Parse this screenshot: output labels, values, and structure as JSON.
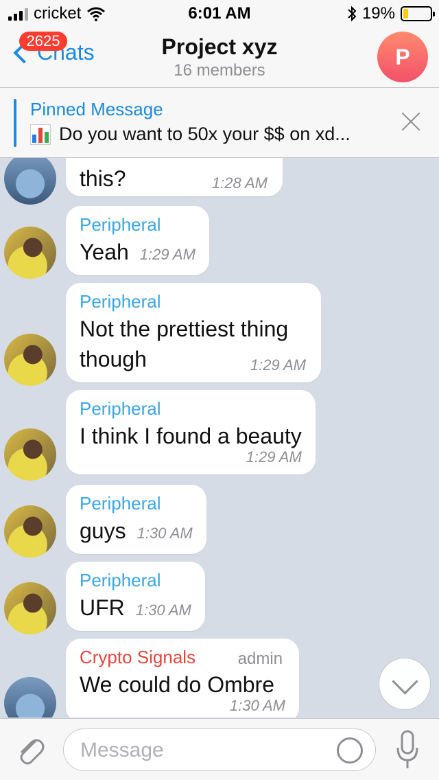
{
  "status_bar": {
    "carrier": "cricket",
    "time": "6:01 AM",
    "battery_percent": "19%",
    "battery_level": 0.19,
    "icons": [
      "signal-icon",
      "wifi-icon",
      "bluetooth-icon",
      "battery-icon"
    ]
  },
  "header": {
    "back_label": "Chats",
    "unread_badge": "2625",
    "title": "Project xyz",
    "subtitle": "16 members",
    "avatar_letter": "P"
  },
  "pinned": {
    "title": "Pinned Message",
    "text": "Do you want to 50x your $$ on xd..."
  },
  "messages": [
    {
      "sender": "",
      "text": "this?",
      "time": "1:28 AM"
    },
    {
      "sender": "Peripheral",
      "text": "Yeah",
      "time": "1:29 AM"
    },
    {
      "sender": "Peripheral",
      "text": "Not the prettiest thing though",
      "time": "1:29 AM"
    },
    {
      "sender": "Peripheral",
      "text": "I think I found a beauty",
      "time": "1:29 AM"
    },
    {
      "sender": "Peripheral",
      "text": "guys",
      "time": "1:30 AM"
    },
    {
      "sender": "Peripheral",
      "text": "UFR",
      "time": "1:30 AM"
    },
    {
      "sender": "Crypto Signals",
      "role": "admin",
      "text": "We could do Ombre",
      "time": "1:30 AM"
    }
  ],
  "input": {
    "placeholder": "Message"
  },
  "colors": {
    "accent": "#1a8be0",
    "sender_name": "#3ba6e6",
    "admin_sender": "#e5463c",
    "badge": "#fb3c2f",
    "chat_background": "#d6dce6"
  }
}
